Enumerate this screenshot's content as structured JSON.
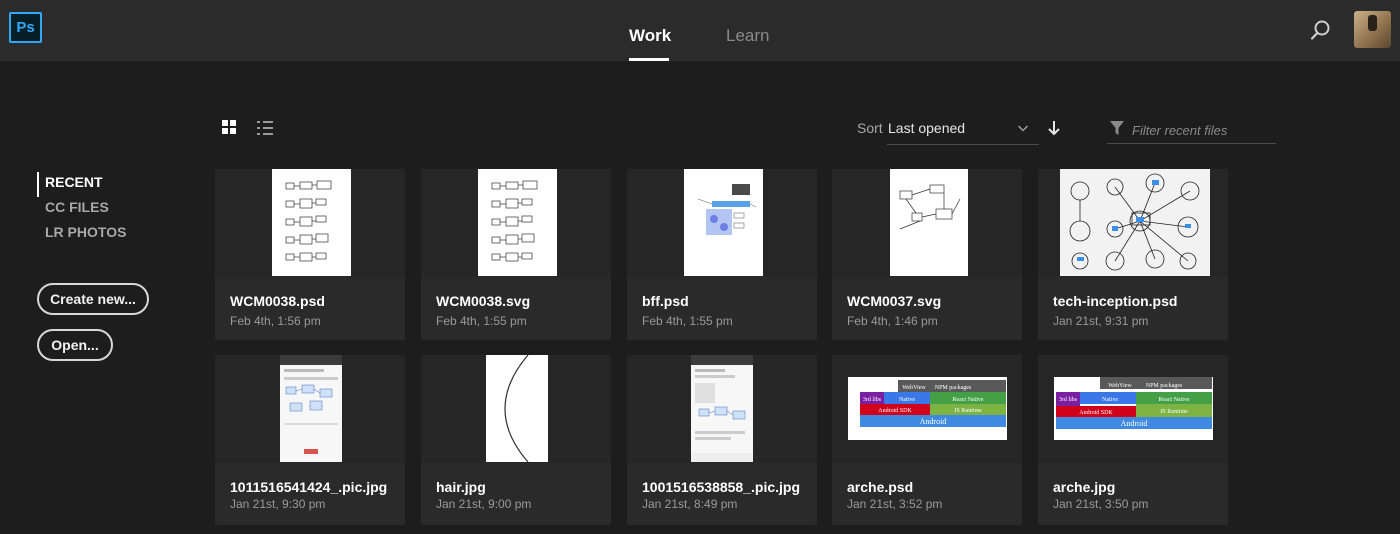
{
  "app": {
    "logo_text": "Ps",
    "brand_color": "#31a8ff"
  },
  "header": {
    "tabs": [
      {
        "label": "Work",
        "active": true
      },
      {
        "label": "Learn",
        "active": false
      }
    ],
    "search_icon": "search-icon",
    "avatar": "user-avatar"
  },
  "sidebar": {
    "items": [
      {
        "label": "RECENT",
        "active": true
      },
      {
        "label": "CC FILES",
        "active": false
      },
      {
        "label": "LR PHOTOS",
        "active": false
      }
    ],
    "create_label": "Create new...",
    "open_label": "Open..."
  },
  "toolbar": {
    "view_modes": [
      "grid-view-icon",
      "list-view-icon"
    ],
    "active_view": "grid",
    "sort_label": "Sort",
    "sort_value": "Last opened",
    "sort_direction": "descending",
    "filter_placeholder": "Filter recent files"
  },
  "files": [
    {
      "name": "WCM0038.psd",
      "date": "Feb 4th, 1:56 pm",
      "thumb": "flow-diagram-portrait"
    },
    {
      "name": "WCM0038.svg",
      "date": "Feb 4th, 1:55 pm",
      "thumb": "flow-diagram-portrait"
    },
    {
      "name": "bff.psd",
      "date": "Feb 4th, 1:55 pm",
      "thumb": "architecture-diagram-blue"
    },
    {
      "name": "WCM0037.svg",
      "date": "Feb 4th, 1:46 pm",
      "thumb": "sketch-diagram-portrait"
    },
    {
      "name": "tech-inception.psd",
      "date": "Jan 21st, 9:31 pm",
      "thumb": "mind-map-sketch"
    },
    {
      "name": "1011516541424_.pic.jpg",
      "date": "Jan 21st, 9:30 pm",
      "thumb": "phone-screenshot"
    },
    {
      "name": "hair.jpg",
      "date": "Jan 21st, 9:00 pm",
      "thumb": "curve-line"
    },
    {
      "name": "1001516538858_.pic.jpg",
      "date": "Jan 21st, 8:49 pm",
      "thumb": "phone-screenshot"
    },
    {
      "name": "arche.psd",
      "date": "Jan 21st, 3:52 pm",
      "thumb": "layer-stack-diagram"
    },
    {
      "name": "arche.jpg",
      "date": "Jan 21st, 3:50 pm",
      "thumb": "layer-stack-diagram"
    }
  ],
  "stack_diagram": {
    "top_labels": [
      "WebView",
      "NPM packages"
    ],
    "mid_labels": [
      "3rd libs",
      "Native",
      "React Native"
    ],
    "low_labels": [
      "Android SDK",
      "JS Runtime"
    ],
    "base_label": "Android",
    "colors": {
      "grey": "#595959",
      "purple": "#7a1fa2",
      "blue": "#3b78e7",
      "green": "#43a047",
      "red": "#d0021b",
      "yellowgreen": "#7cb342",
      "base": "#3f8ae0"
    }
  }
}
